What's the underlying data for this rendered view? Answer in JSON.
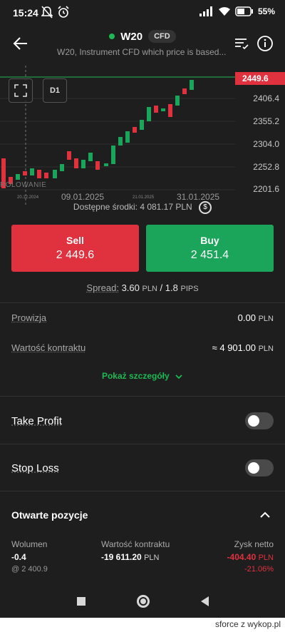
{
  "status": {
    "time": "15:24",
    "battery": "55%"
  },
  "header": {
    "title": "W20",
    "badge": "CFD",
    "subtitle": "W20, Instrument CFD which price is based..."
  },
  "chart": {
    "current_price": "2449.6",
    "ticks": [
      "2406.4",
      "2355.2",
      "2304.0",
      "2252.8",
      "2201.6"
    ],
    "timeframe": "D1",
    "dates": [
      "09.01.2025",
      "31.01.2025"
    ],
    "dates_small": [
      "20.12.2024",
      "21.01.2025"
    ],
    "watermark": "ROLOWANIE"
  },
  "funds": {
    "label": "Dostępne środki:",
    "value": "4 081.17",
    "currency": "PLN"
  },
  "sell": {
    "label": "Sell",
    "price": "2 449.6"
  },
  "buy": {
    "label": "Buy",
    "price": "2 451.4"
  },
  "spread": {
    "label": "Spread:",
    "value": "3.60",
    "currency": "PLN",
    "sep": "/",
    "pips": "1.8",
    "pips_unit": "PIPS"
  },
  "details": [
    {
      "key": "Prowizja",
      "value": "0.00",
      "unit": "PLN"
    },
    {
      "key": "Wartość kontraktu",
      "value": "≈ 4 901.00",
      "unit": "PLN"
    }
  ],
  "show_details": "Pokaż szczegóły",
  "take_profit": "Take Profit",
  "stop_loss": "Stop Loss",
  "positions": {
    "title": "Otwarte pozycje",
    "volume_label": "Wolumen",
    "volume": "-0.4",
    "open_price": "@ 2 400.9",
    "value_label": "Wartość kontraktu",
    "value": "-19 611.20",
    "value_unit": "PLN",
    "profit_label": "Zysk netto",
    "profit": "-404.40",
    "profit_unit": "PLN",
    "profit_pct": "-21.06%"
  },
  "footer": {
    "watermark": "sforce z wykop.pl"
  },
  "colors": {
    "sell": "#e0313f",
    "buy": "#1aa55a",
    "accent": "#1db954"
  },
  "icons": [
    "back-arrow-icon",
    "sort-filter-icon",
    "info-icon",
    "expand-icon",
    "wallet-icon",
    "chevron-down-icon",
    "chevron-up-icon"
  ]
}
